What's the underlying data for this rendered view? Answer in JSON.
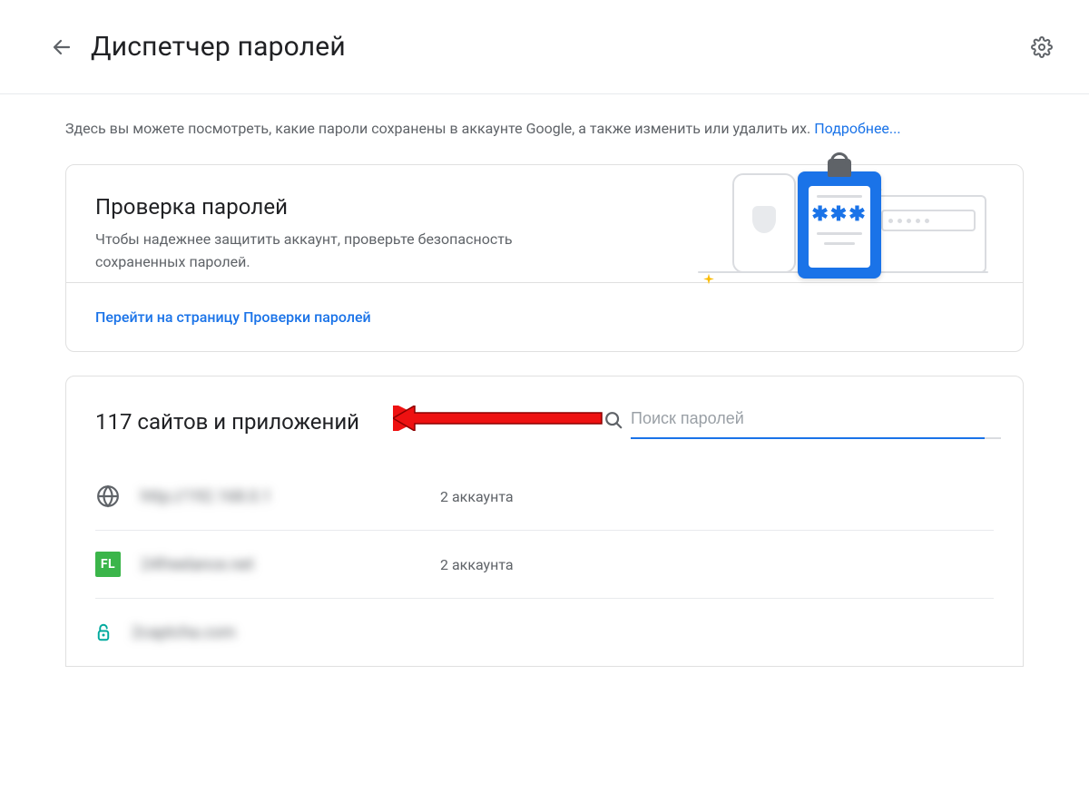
{
  "header": {
    "title": "Диспетчер паролей"
  },
  "intro": {
    "text": "Здесь вы можете посмотреть, какие пароли сохранены в аккаунте Google, а также изменить или удалить их. ",
    "link_label": "Подробнее..."
  },
  "checkup": {
    "title": "Проверка паролей",
    "description": "Чтобы надежнее защитить аккаунт, проверьте безопасность сохраненных паролей.",
    "link_label": "Перейти на страницу Проверки паролей",
    "illustration_stars": "✱✱✱"
  },
  "list": {
    "count_label": "117 сайтов и приложений",
    "search_placeholder": "Поиск паролей"
  },
  "sites": [
    {
      "name": "http://192.168.0.1",
      "accounts_label": "2 аккаунта",
      "icon": "globe"
    },
    {
      "name": "24freelance.net",
      "accounts_label": "2 аккаунта",
      "icon": "fl"
    },
    {
      "name": "2captcha.com",
      "accounts_label": "",
      "icon": "captcha"
    }
  ]
}
